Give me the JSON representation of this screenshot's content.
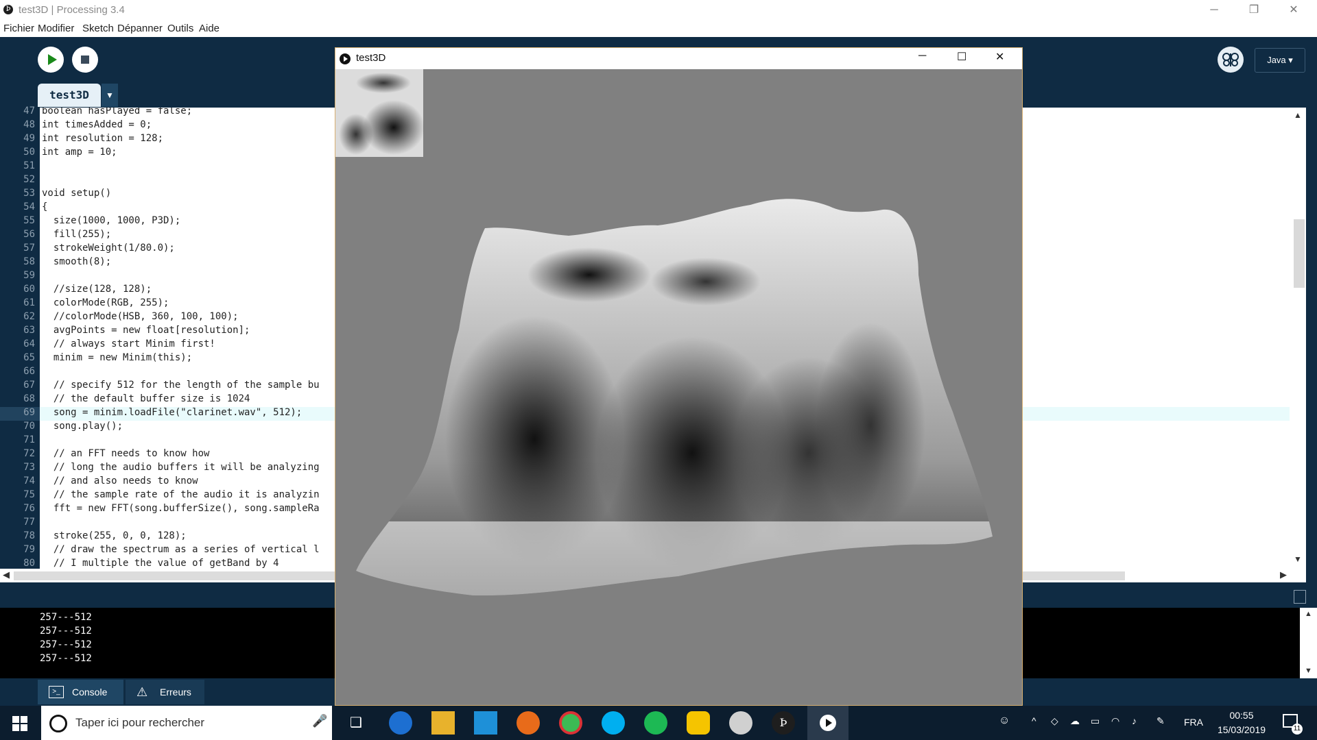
{
  "window": {
    "title": "test3D | Processing 3.4",
    "app_icon_glyph": "Þ"
  },
  "menu": [
    "Fichier",
    "Modifier",
    "Sketch",
    "Dépanner",
    "Outils",
    "Aide"
  ],
  "toolbar": {
    "mode_label": "Java ▾",
    "tab_label": "test3D",
    "tab_menu_glyph": "▼"
  },
  "editor": {
    "line_numbers": [
      "47",
      "48",
      "49",
      "50",
      "51",
      "52",
      "53",
      "54",
      "55",
      "56",
      "57",
      "58",
      "59",
      "60",
      "61",
      "62",
      "63",
      "64",
      "65",
      "66",
      "67",
      "68",
      "69",
      "70",
      "71",
      "72",
      "73",
      "74",
      "75",
      "76",
      "77",
      "78",
      "79",
      "80"
    ],
    "lines": [
      "boolean hasPlayed = false;",
      "int timesAdded = 0;",
      "int resolution = 128;",
      "int amp = 10;",
      "",
      "",
      "void setup()",
      "{",
      "  size(1000, 1000, P3D);",
      "  fill(255);",
      "  strokeWeight(1/80.0);",
      "  smooth(8);",
      "",
      "  //size(128, 128);",
      "  colorMode(RGB, 255);",
      "  //colorMode(HSB, 360, 100, 100);",
      "  avgPoints = new float[resolution];",
      "  // always start Minim first!",
      "  minim = new Minim(this);",
      "",
      "  // specify 512 for the length of the sample bu",
      "  // the default buffer size is 1024",
      "  song = minim.loadFile(\"clarinet.wav\", 512);",
      "  song.play();",
      "",
      "  // an FFT needs to know how",
      "  // long the audio buffers it will be analyzing",
      "  // and also needs to know",
      "  // the sample rate of the audio it is analyzin",
      "  fft = new FFT(song.bufferSize(), song.sampleRa",
      "",
      "  stroke(255, 0, 0, 128);",
      "  // draw the spectrum as a series of vertical l",
      "  // I multiple the value of getBand by 4"
    ],
    "highlighted_line": "69"
  },
  "console": {
    "lines": [
      "257---512",
      "257---512",
      "257---512",
      "257---512"
    ],
    "tab_console": "Console",
    "tab_errors": "Erreurs"
  },
  "sketch_window": {
    "title": "test3D"
  },
  "taskbar": {
    "search_placeholder": "Taper ici pour rechercher",
    "language": "FRA",
    "time": "00:55",
    "date": "15/03/2019",
    "notification_count": "11"
  },
  "colors": {
    "ide_background": "#0f2b43",
    "tab_active": "#e6f0f7",
    "console_background": "#000000",
    "sketch_background": "#808080"
  }
}
